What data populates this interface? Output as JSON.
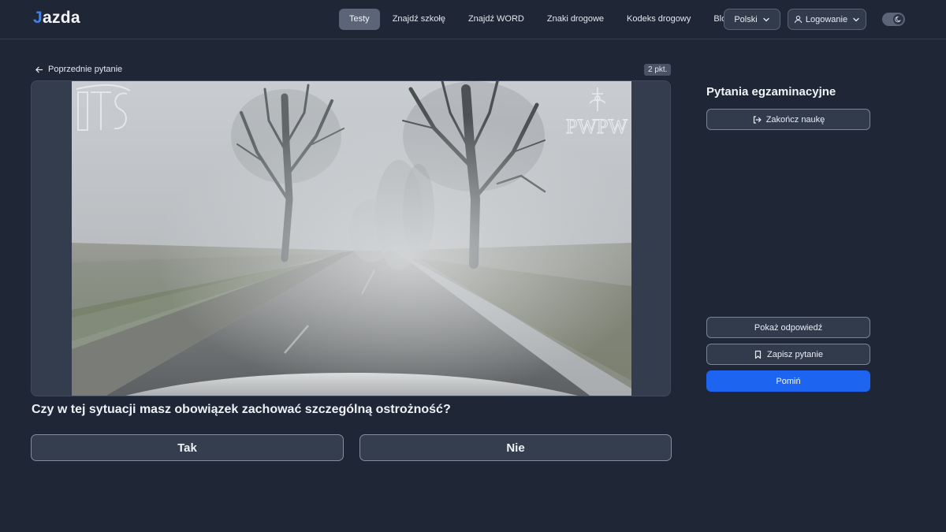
{
  "header": {
    "logo_mark": "J",
    "logo_text": "azda",
    "nav": [
      {
        "label": "Testy",
        "active": true
      },
      {
        "label": "Znajdź szkołę",
        "active": false
      },
      {
        "label": "Znajdź WORD",
        "active": false
      },
      {
        "label": "Znaki drogowe",
        "active": false
      },
      {
        "label": "Kodeks drogowy",
        "active": false
      },
      {
        "label": "Blog",
        "active": false
      }
    ],
    "language": {
      "selected": "Polski",
      "icon": "chevron-down-icon"
    },
    "login": {
      "label": "Logowanie",
      "icon": "user-icon"
    },
    "theme_toggle": {
      "icon": "moon-icon"
    }
  },
  "main": {
    "prev_question_label": "Poprzednie pytanie",
    "points_badge": "2 pkt.",
    "media": {
      "watermark_left": "ITS",
      "watermark_right": "PWPW",
      "scene": "foggy-road"
    },
    "question": "Czy w tej sytuacji masz obowiązek zachować szczególną ostrożność?",
    "answers": [
      {
        "label": "Tak"
      },
      {
        "label": "Nie"
      }
    ]
  },
  "side": {
    "title": "Pytania egzaminacyjne",
    "finish_label": "Zakończ naukę",
    "show_answer_label": "Pokaż odpowiedź",
    "save_question_label": "Zapisz pytanie",
    "skip_label": "Pomiń"
  },
  "colors": {
    "background": "#1f2636",
    "accent": "#1d64f0",
    "logo_accent": "#3b82f6"
  }
}
